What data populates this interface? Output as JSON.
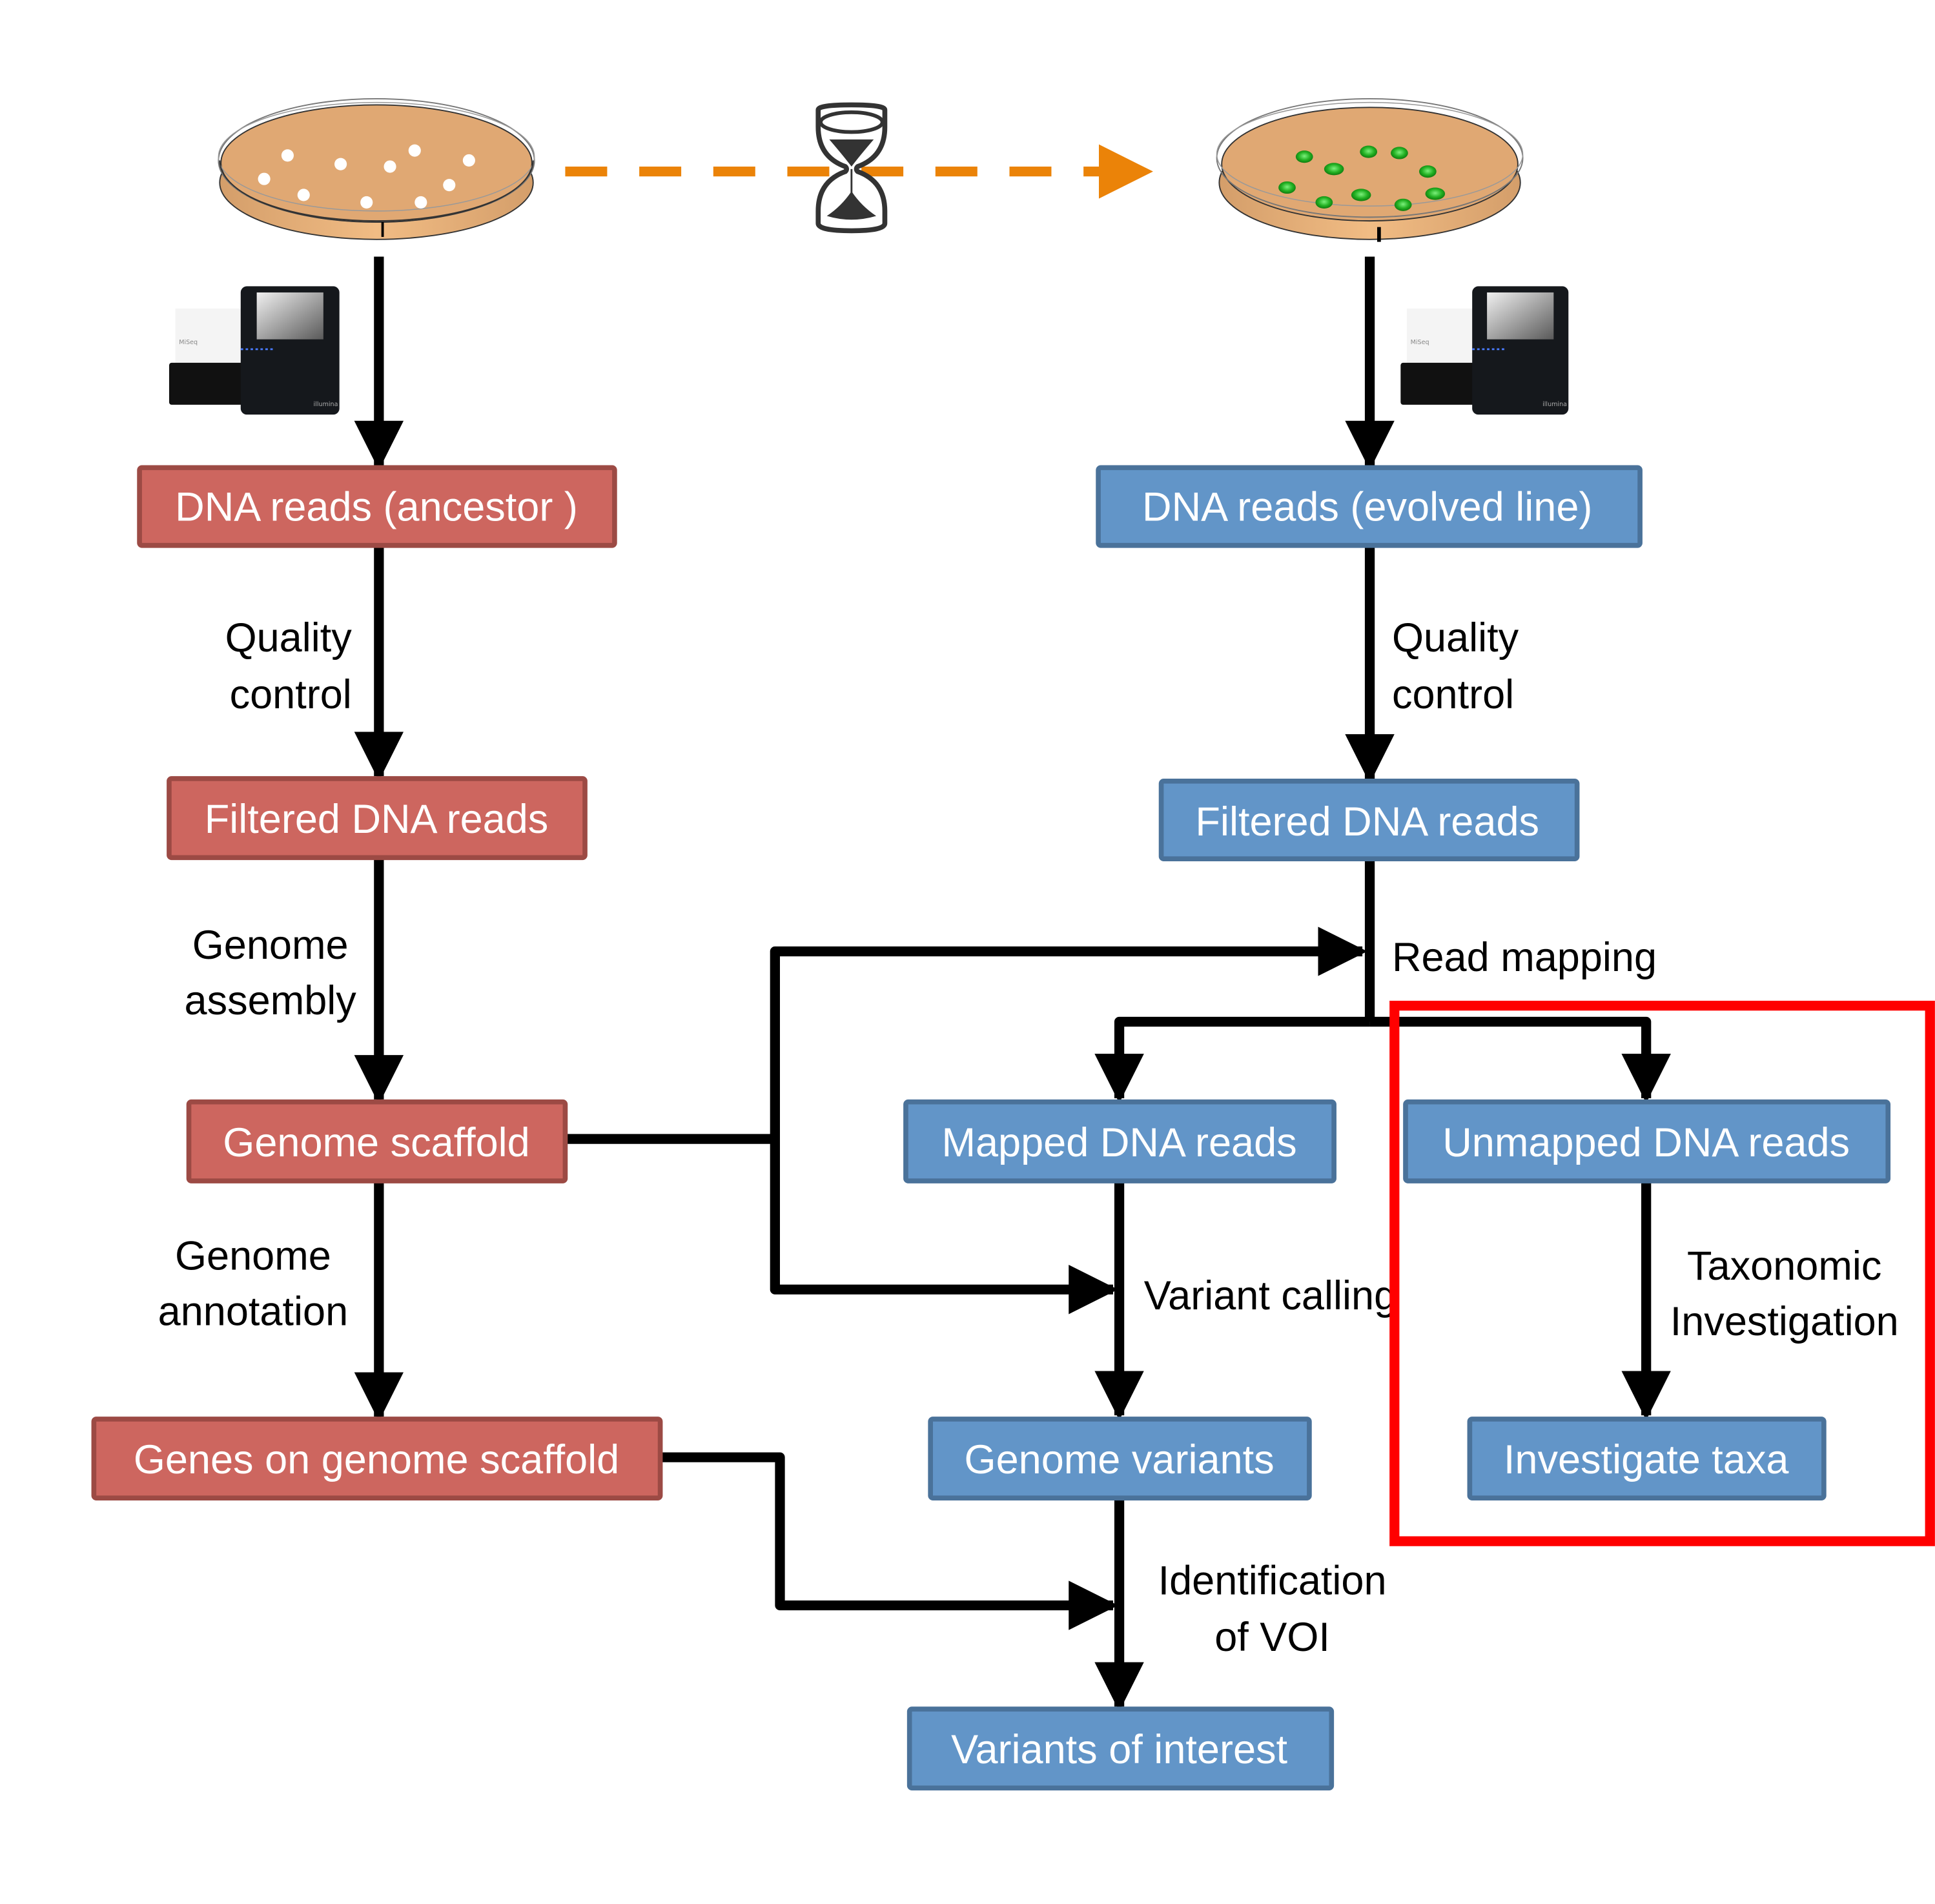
{
  "colors": {
    "ancestor_fill": "#CD665F",
    "ancestor_border": "#9C4A44",
    "evolved_fill": "#6295C8",
    "evolved_border": "#4A729A",
    "arrow": "#000000",
    "time_arrow": "#EB8308",
    "highlight": "#FF0000",
    "agar": "#E0A873",
    "colony_ancestor": "#FFFFFF",
    "colony_evolved": "#22AA22"
  },
  "icons": {
    "ancestor_dish": "petri-dish-white-colonies",
    "evolved_dish": "petri-dish-green-colonies",
    "time": "hourglass",
    "sequencer": "sequencer-machine"
  },
  "sequencer": {
    "model": "MiSeq",
    "brand": "illumina"
  },
  "ancestor": {
    "boxes": [
      "DNA reads (ancestor )",
      "Filtered DNA reads",
      "Genome scaffold",
      "Genes on genome scaffold"
    ],
    "steps": [
      [
        "Quality",
        "control"
      ],
      [
        "Genome",
        "assembly"
      ],
      [
        "Genome",
        "annotation"
      ]
    ]
  },
  "evolved": {
    "boxes": [
      "DNA reads (evolved  line)",
      "Filtered DNA reads",
      "Mapped DNA reads",
      "Unmapped DNA reads",
      "Genome variants",
      "Investigate taxa",
      "Variants of interest"
    ],
    "steps": {
      "qc": [
        "Quality",
        "control"
      ],
      "mapping": "Read mapping",
      "calling": "Variant calling",
      "taxonomic": [
        "Taxonomic",
        "Investigation"
      ],
      "voi": [
        "Identification",
        "of VOI"
      ]
    }
  }
}
